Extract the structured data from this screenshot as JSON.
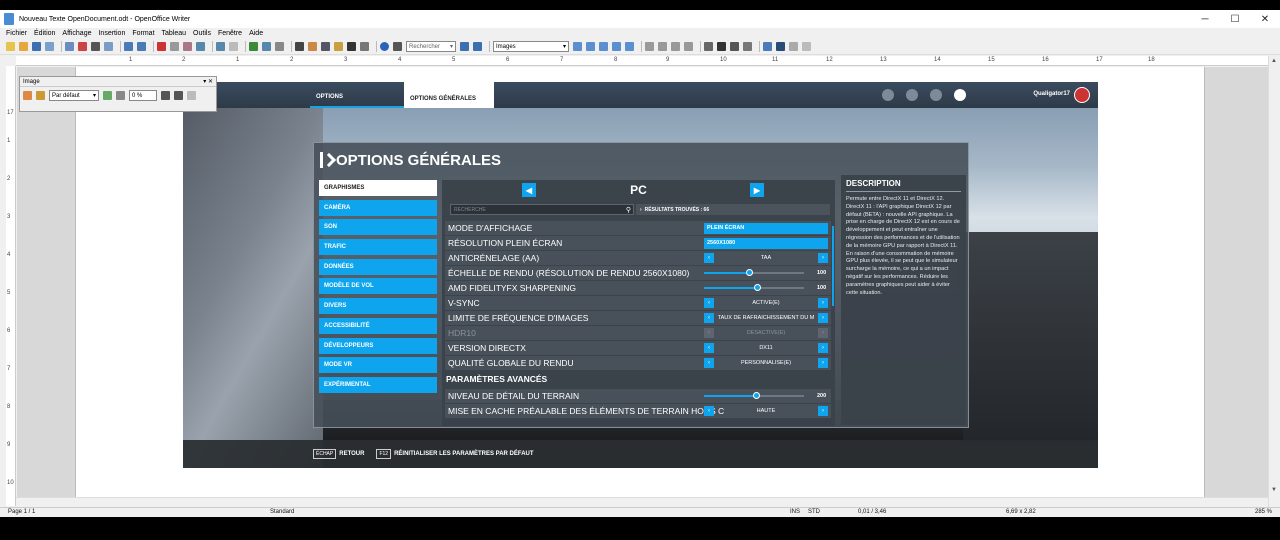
{
  "window": {
    "title": "Nouveau Texte OpenDocument.odt - OpenOffice Writer",
    "min": "─",
    "max": "☐",
    "close": "✕"
  },
  "menu": [
    "Fichier",
    "Édition",
    "Affichage",
    "Insertion",
    "Format",
    "Tableau",
    "Outils",
    "Fenêtre",
    "Aide"
  ],
  "toolbar": {
    "find_placeholder": "Rechercher",
    "style_select": "Images"
  },
  "ruler": {
    "h": [
      "1",
      "2",
      "1",
      "2",
      "3",
      "4",
      "5",
      "6",
      "7",
      "8",
      "9",
      "10",
      "11",
      "12",
      "13",
      "14",
      "15",
      "16",
      "17",
      "18"
    ],
    "v": [
      "17",
      "1",
      "2",
      "3",
      "4",
      "5",
      "6",
      "7",
      "8",
      "9",
      "10"
    ]
  },
  "image_toolbar": {
    "title": "Image",
    "filter": "Par défaut",
    "percent": "0 %"
  },
  "statusbar": {
    "page": "Page 1 / 1",
    "style": "Standard",
    "mode": "INS",
    "sel": "STD",
    "pos": "0,01 / 3,46",
    "size": "6,69 x 2,82",
    "zoom": "285 %"
  },
  "game": {
    "tab_options": "OPTIONS",
    "tab_general": "OPTIONS GÉNÉRALES",
    "username": "Qualigator17",
    "heading": "OPTIONS GÉNÉRALES",
    "categories": [
      "GRAPHISMES",
      "CAMÉRA",
      "SON",
      "TRAFIC",
      "DONNÉES",
      "MODÈLE DE VOL",
      "DIVERS",
      "ACCESSIBILITÉ",
      "DÉVELOPPEURS",
      "MODE VR",
      "EXPÉRIMENTAL"
    ],
    "platform": "PC",
    "search_placeholder": "RECHERCHE",
    "results": "RÉSULTATS TROUVÉS : 66",
    "settings": [
      {
        "label": "MODE D'AFFICHAGE",
        "kind": "full",
        "value": "PLEIN ÉCRAN"
      },
      {
        "label": "RÉSOLUTION PLEIN ÉCRAN",
        "kind": "full",
        "value": "2560X1080"
      },
      {
        "label": "ANTICRÉNELAGE (AA)",
        "kind": "select",
        "value": "TAA"
      },
      {
        "label": "ÉCHELLE DE RENDU (RÉSOLUTION DE RENDU 2560X1080)",
        "kind": "slider",
        "value": "100",
        "fill": 0.45
      },
      {
        "label": "AMD FIDELITYFX SHARPENING",
        "kind": "slider",
        "value": "100",
        "fill": 0.53
      },
      {
        "label": "V-SYNC",
        "kind": "select",
        "value": "ACTIVÉ(E)"
      },
      {
        "label": "LIMITE DE FRÉQUENCE D'IMAGES",
        "kind": "select",
        "value": "TAUX DE RAFRAÎCHISSEMENT DU M"
      },
      {
        "label": "HDR10",
        "kind": "select",
        "value": "DÉSACTIVÉ(E)",
        "dim": true
      },
      {
        "label": "VERSION DIRECTX",
        "kind": "select",
        "value": "DX11"
      },
      {
        "label": "QUALITÉ GLOBALE DU RENDU",
        "kind": "select",
        "value": "PERSONNALISÉ(E)"
      }
    ],
    "advanced_heading": "PARAMÈTRES AVANCÉS",
    "advanced": [
      {
        "label": "NIVEAU DE DÉTAIL DU TERRAIN",
        "kind": "slider",
        "value": "200",
        "fill": 0.52
      },
      {
        "label": "MISE EN CACHE PRÉALABLE DES ÉLÉMENTS DE TERRAIN HORS C",
        "kind": "select",
        "value": "HAUTE"
      }
    ],
    "desc_title": "DESCRIPTION",
    "desc_body": "Permute entre DirectX 11 et DirectX 12. DirectX 11 : l'API graphique DirectX 12 par défaut (BETA) : nouvelle API graphique. La prise en charge de DirectX 12 est en cours de développement et peut entraîner une régression des performances et de l'utilisation de la mémoire GPU par rapport à DirectX 11. En raison d'une consommation de mémoire GPU plus élevée, il se peut que le simulateur surcharge la mémoire, ce qui a un impact négatif sur les performances. Réduire les paramètres graphiques peut aider à éviter cette situation.",
    "key_back": "ÉCHAP",
    "back_label": "RETOUR",
    "key_reset": "F12",
    "reset_label": "RÉINITIALISER LES PARAMÈTRES PAR DÉFAUT"
  }
}
